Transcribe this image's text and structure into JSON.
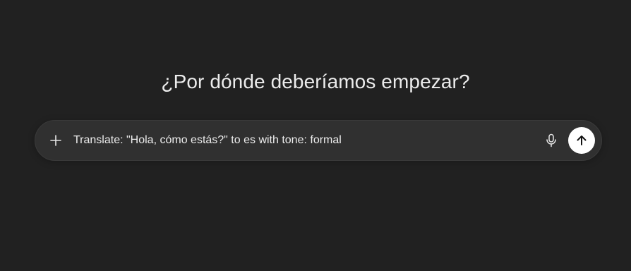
{
  "heading": "¿Por dónde deberíamos empezar?",
  "composer": {
    "value": "Translate: \"Hola, cómo estás?\" to es with tone: formal",
    "buttons": {
      "attach_icon": "plus-icon",
      "dictate_icon": "microphone-icon",
      "send_icon": "arrow-up-icon"
    }
  },
  "colors": {
    "background": "#212121",
    "composer_background": "#303030",
    "text": "#ececec",
    "send_button": "#ffffff"
  }
}
